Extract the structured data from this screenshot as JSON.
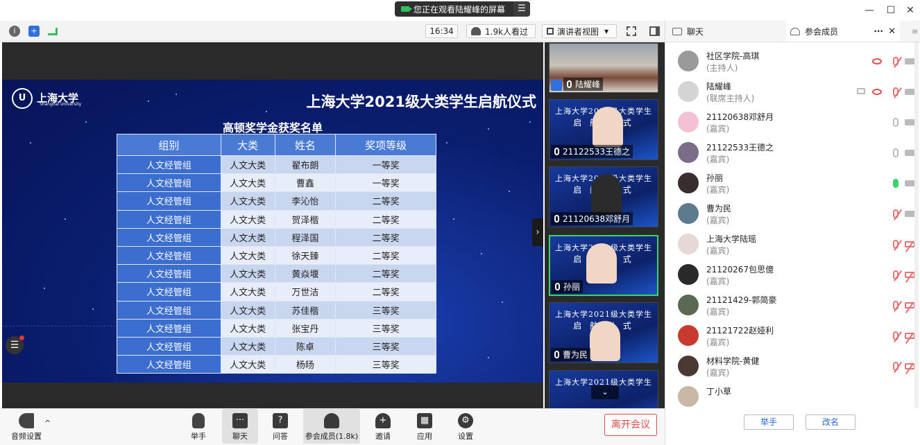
{
  "share_banner": {
    "text": "您正在观看陆耀峰的屏幕",
    "menu_glyph": "☰"
  },
  "window": {
    "minimize": "—",
    "maximize": "☐",
    "close": "✕"
  },
  "toolbar": {
    "time": "16:34",
    "viewers": "1.9k人看过",
    "view_mode": "演讲者视图",
    "view_caret": "▼"
  },
  "slide": {
    "logo_text": "上海大学",
    "logo_sub": "Shanghai University",
    "title": "上海大学2021级大类学生启航仪式",
    "subtitle": "高顿奖学金获奖名单",
    "headers": [
      "组别",
      "大类",
      "姓名",
      "奖项等级"
    ],
    "rows": [
      [
        "人文经管组",
        "人文大类",
        "翟布朗",
        "一等奖"
      ],
      [
        "人文经管组",
        "人文大类",
        "曹鑫",
        "一等奖"
      ],
      [
        "人文经管组",
        "人文大类",
        "李沁怡",
        "二等奖"
      ],
      [
        "人文经管组",
        "人文大类",
        "贺泽楷",
        "二等奖"
      ],
      [
        "人文经管组",
        "人文大类",
        "程泽国",
        "二等奖"
      ],
      [
        "人文经管组",
        "人文大类",
        "徐天臻",
        "二等奖"
      ],
      [
        "人文经管组",
        "人文大类",
        "黄焱堰",
        "二等奖"
      ],
      [
        "人文经管组",
        "人文大类",
        "万世洁",
        "二等奖"
      ],
      [
        "人文经管组",
        "人文大类",
        "苏佳楷",
        "三等奖"
      ],
      [
        "人文经管组",
        "人文大类",
        "张宝丹",
        "三等奖"
      ],
      [
        "人文经管组",
        "人文大类",
        "陈卓",
        "三等奖"
      ],
      [
        "人文经管组",
        "人文大类",
        "杨旸",
        "三等奖"
      ]
    ]
  },
  "thumbs": [
    {
      "name": "陆耀峰",
      "title1": "",
      "title2": ""
    },
    {
      "name": "21122533王德之",
      "title1": "上海大学2021级大类学生",
      "title2": "启 航 仪 式"
    },
    {
      "name": "21120638邓舒月",
      "title1": "上海大学2021级大类学生",
      "title2": "启 航 仪 式"
    },
    {
      "name": "孙丽",
      "title1": "上海大学2021级大类学生",
      "title2": "启 航 仪 式"
    },
    {
      "name": "曹为民",
      "title1": "上海大学2021级大类学生",
      "title2": "启 航 仪 式"
    },
    {
      "name": "",
      "title1": "上海大学2021级大类学生",
      "title2": ""
    }
  ],
  "bottom_bar": {
    "audio": "音频设置",
    "raise_hand": "举手",
    "chat": "聊天",
    "qa": "问答",
    "participants": "参会成员(1.8k)",
    "invite": "邀请",
    "apps": "应用",
    "settings": "设置",
    "leave": "离开会议"
  },
  "right_panel": {
    "tab_chat": "聊天",
    "tab_members": "参会成员",
    "more": "···",
    "close": "✕",
    "raise_hand": "举手",
    "rename": "改名",
    "members": [
      {
        "name": "社区学院-高琪",
        "role": "(主持人)",
        "icons": [
          "eye",
          "mic-off",
          "cam"
        ]
      },
      {
        "name": "陆耀峰",
        "role": "(联席主持人)",
        "icons": [
          "scr",
          "eye",
          "mic-off",
          "cam"
        ]
      },
      {
        "name": "21120638邓舒月",
        "role": "(嘉宾)",
        "icons": [
          "mic-ok",
          "cam"
        ]
      },
      {
        "name": "21122533王德之",
        "role": "(嘉宾)",
        "icons": [
          "mic-ok",
          "cam"
        ]
      },
      {
        "name": "孙丽",
        "role": "(嘉宾)",
        "icons": [
          "mic-on",
          "cam"
        ]
      },
      {
        "name": "曹为民",
        "role": "(嘉宾)",
        "icons": [
          "mic-off",
          "cam"
        ]
      },
      {
        "name": "上海大学陆瑶",
        "role": "(嘉宾)",
        "icons": [
          "mic-off",
          "cam-off"
        ]
      },
      {
        "name": "21120267包思億",
        "role": "(嘉宾)",
        "icons": [
          "mic-off",
          "cam-off"
        ]
      },
      {
        "name": "21121429-郭简豪",
        "role": "(嘉宾)",
        "icons": [
          "mic-off",
          "cam-off"
        ]
      },
      {
        "name": "21121722赵娅利",
        "role": "(嘉宾)",
        "icons": [
          "mic-off",
          "cam-off"
        ]
      },
      {
        "name": "材料学院-黄健",
        "role": "(嘉宾)",
        "icons": [
          "mic-off",
          "cam-off"
        ]
      },
      {
        "name": "丁小草",
        "role": "",
        "icons": []
      }
    ]
  },
  "colors": {
    "accent": "#2a6ad6",
    "leave": "#e24a4a",
    "active_mic": "#3bd36b",
    "slide_bg": "#0a1e6e"
  }
}
